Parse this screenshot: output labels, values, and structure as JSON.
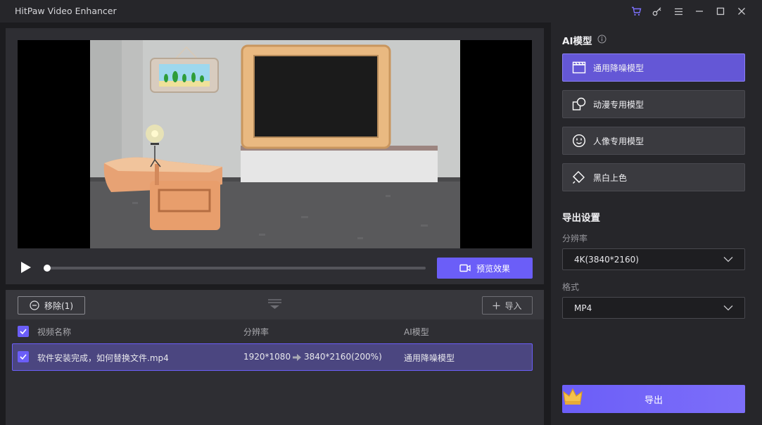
{
  "app": {
    "title": "HitPaw Video Enhancer"
  },
  "player": {
    "preview_label": "预览效果",
    "progress": 0.0
  },
  "list": {
    "remove_label": "移除(1)",
    "import_label": "导入",
    "columns": {
      "name": "视频名称",
      "resolution": "分辨率",
      "model": "AI模型"
    },
    "rows": [
      {
        "name": "软件安装完成，如何替换文件.mp4",
        "res_from": "1920*1080",
        "res_to": "3840*2160(200%)",
        "model": "通用降噪模型"
      }
    ]
  },
  "ai": {
    "title": "AI模型",
    "models": [
      {
        "label": "通用降噪模型",
        "icon": "clapperboard-icon",
        "active": true
      },
      {
        "label": "动漫专用模型",
        "icon": "shapes-icon",
        "active": false
      },
      {
        "label": "人像专用模型",
        "icon": "face-icon",
        "active": false
      },
      {
        "label": "黑白上色",
        "icon": "paint-bucket-icon",
        "active": false
      }
    ]
  },
  "export": {
    "title": "导出设置",
    "resolution_label": "分辨率",
    "resolution_value": "4K(3840*2160)",
    "format_label": "格式",
    "format_value": "MP4",
    "button_label": "导出"
  },
  "colors": {
    "accent": "#6b5ef8",
    "panel": "#2e2e33",
    "sidebar": "#26262a"
  }
}
